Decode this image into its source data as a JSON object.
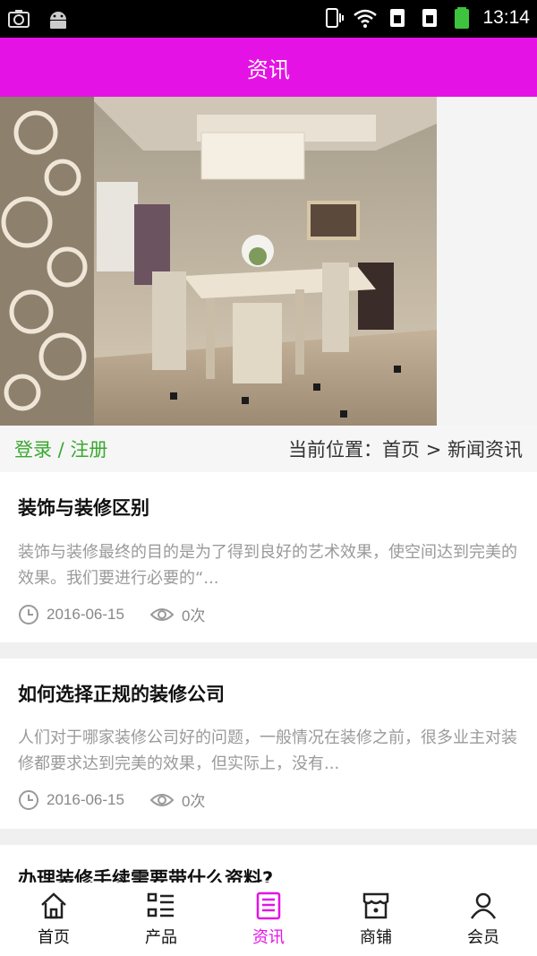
{
  "status": {
    "time": "13:14"
  },
  "header": {
    "title": "资讯"
  },
  "location": {
    "login_text": "登录 / 注册",
    "breadcrumb": "当前位置：首页 > 新闻资讯"
  },
  "articles": [
    {
      "title": "装饰与装修区别",
      "summary": "装饰与装修最终的目的是为了得到良好的艺术效果，使空间达到完美的效果。我们要进行必要的“...",
      "date": "2016-06-15",
      "views": "0次"
    },
    {
      "title": "如何选择正规的装修公司",
      "summary": "人们对于哪家装修公司好的问题，一般情况在装修之前，很多业主对装修都要求达到完美的效果，但实际上，没有...",
      "date": "2016-06-15",
      "views": "0次"
    },
    {
      "title": "办理装修手续需要带什么资料?"
    }
  ],
  "tabs": [
    {
      "label": "首页",
      "icon": "home-icon"
    },
    {
      "label": "产品",
      "icon": "list-icon"
    },
    {
      "label": "资讯",
      "icon": "news-icon"
    },
    {
      "label": "商铺",
      "icon": "shop-icon"
    },
    {
      "label": "会员",
      "icon": "user-icon"
    }
  ],
  "colors": {
    "accent": "#e512e5",
    "login": "#3aa82f"
  }
}
